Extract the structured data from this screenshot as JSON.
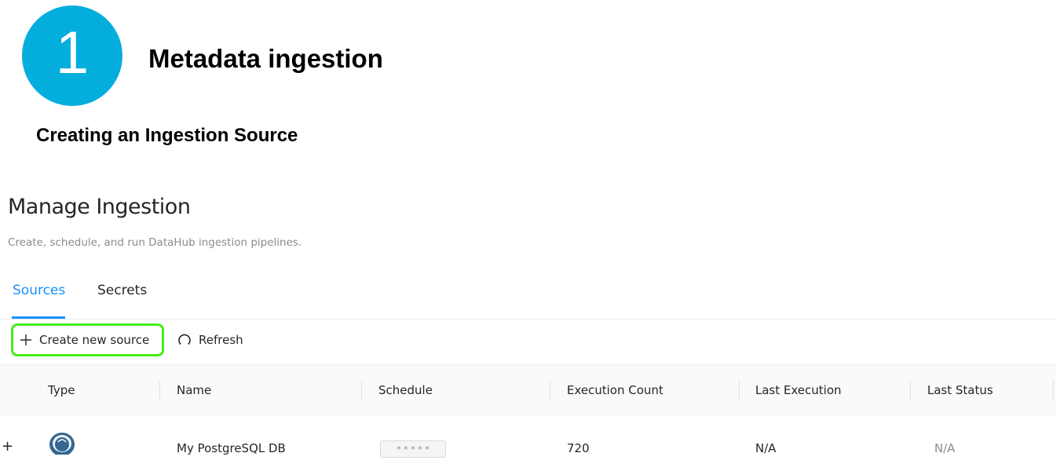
{
  "slide": {
    "step_number": "1",
    "title": "Metadata ingestion",
    "subtitle": "Creating an Ingestion Source",
    "highlight_color": "#44ee12",
    "circle_color": "#03AEDD"
  },
  "page": {
    "title": "Manage Ingestion",
    "description": "Create, schedule, and run DataHub ingestion pipelines."
  },
  "tabs": [
    {
      "label": "Sources",
      "active": true
    },
    {
      "label": "Secrets",
      "active": false
    }
  ],
  "toolbar": {
    "create_label": "Create new source",
    "create_icon": "plus-icon",
    "refresh_label": "Refresh",
    "refresh_icon": "refresh-icon"
  },
  "table": {
    "columns": [
      "Type",
      "Name",
      "Schedule",
      "Execution Count",
      "Last Execution",
      "Last Status"
    ],
    "rows": [
      {
        "type_icon": "postgresql-logo",
        "name": "My PostgreSQL DB",
        "schedule": "* * * * *",
        "execution_count": "720",
        "last_execution": "N/A",
        "last_status": "N/A"
      }
    ]
  },
  "colors": {
    "accent": "#1890ff",
    "text": "#262626",
    "muted": "#8c8c8c"
  }
}
